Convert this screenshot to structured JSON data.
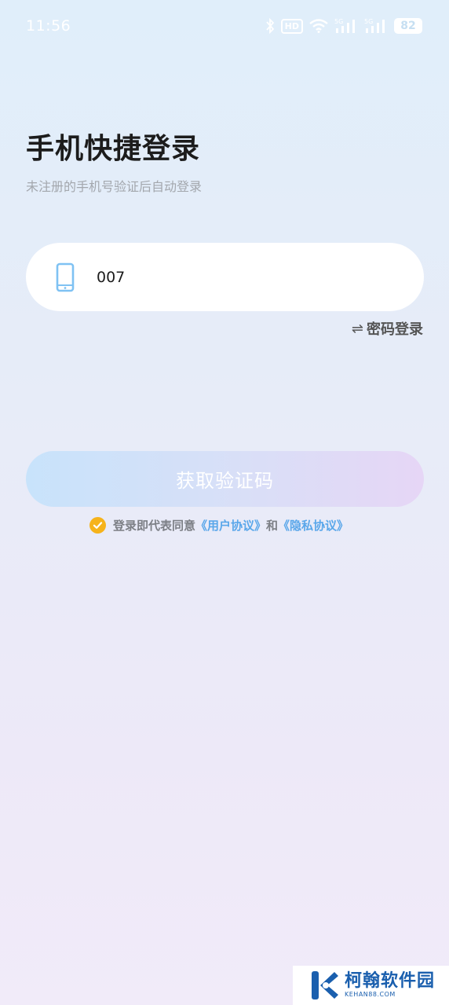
{
  "status_bar": {
    "time": "11:56",
    "hd": "HD",
    "net1": "5G",
    "net2": "5G",
    "battery": "82"
  },
  "login": {
    "title": "手机快捷登录",
    "subtitle": "未注册的手机号验证后自动登录",
    "phone_value": "007",
    "switch_icon": "⇌",
    "switch_label": "密码登录",
    "get_code_label": "获取验证码",
    "agreement_prefix": "登录即代表同意",
    "user_agreement": "《用户协议》",
    "agreement_and": "和",
    "privacy_policy": "《隐私协议》"
  },
  "watermark": {
    "title": "柯翰软件园",
    "sub": "KEHAN88.COM"
  },
  "colors": {
    "accent_link": "#5aa7ea",
    "check": "#f6b31b",
    "phone_icon": "#7fc2f3",
    "watermark": "#1a5fae"
  },
  "icons": [
    "bluetooth-icon",
    "wifi-icon",
    "signal-icon",
    "phone-icon",
    "swap-icon",
    "check-icon",
    "watermark-logo-icon"
  ]
}
